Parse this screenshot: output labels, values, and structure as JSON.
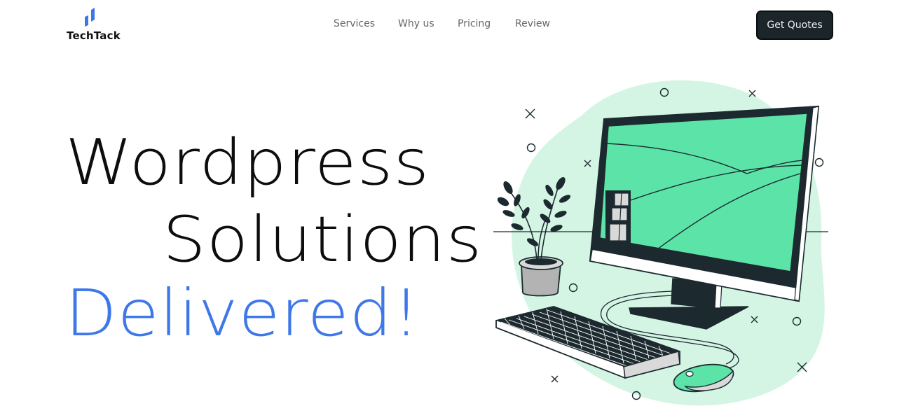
{
  "brand": {
    "name": "TechTack",
    "accent": "#3e78e8"
  },
  "nav": {
    "items": [
      "Services",
      "Why us",
      "Pricing",
      "Review"
    ]
  },
  "cta": {
    "label": "Get Quotes"
  },
  "hero": {
    "line1": "Wordpress",
    "line2": "Solutions",
    "line3": "Delivered!"
  },
  "colors": {
    "screen": "#5ce3a7",
    "blob": "#d4f5e4",
    "dark": "#1c2a30"
  },
  "illustration": {
    "icon": "desktop-computer-illustration"
  }
}
